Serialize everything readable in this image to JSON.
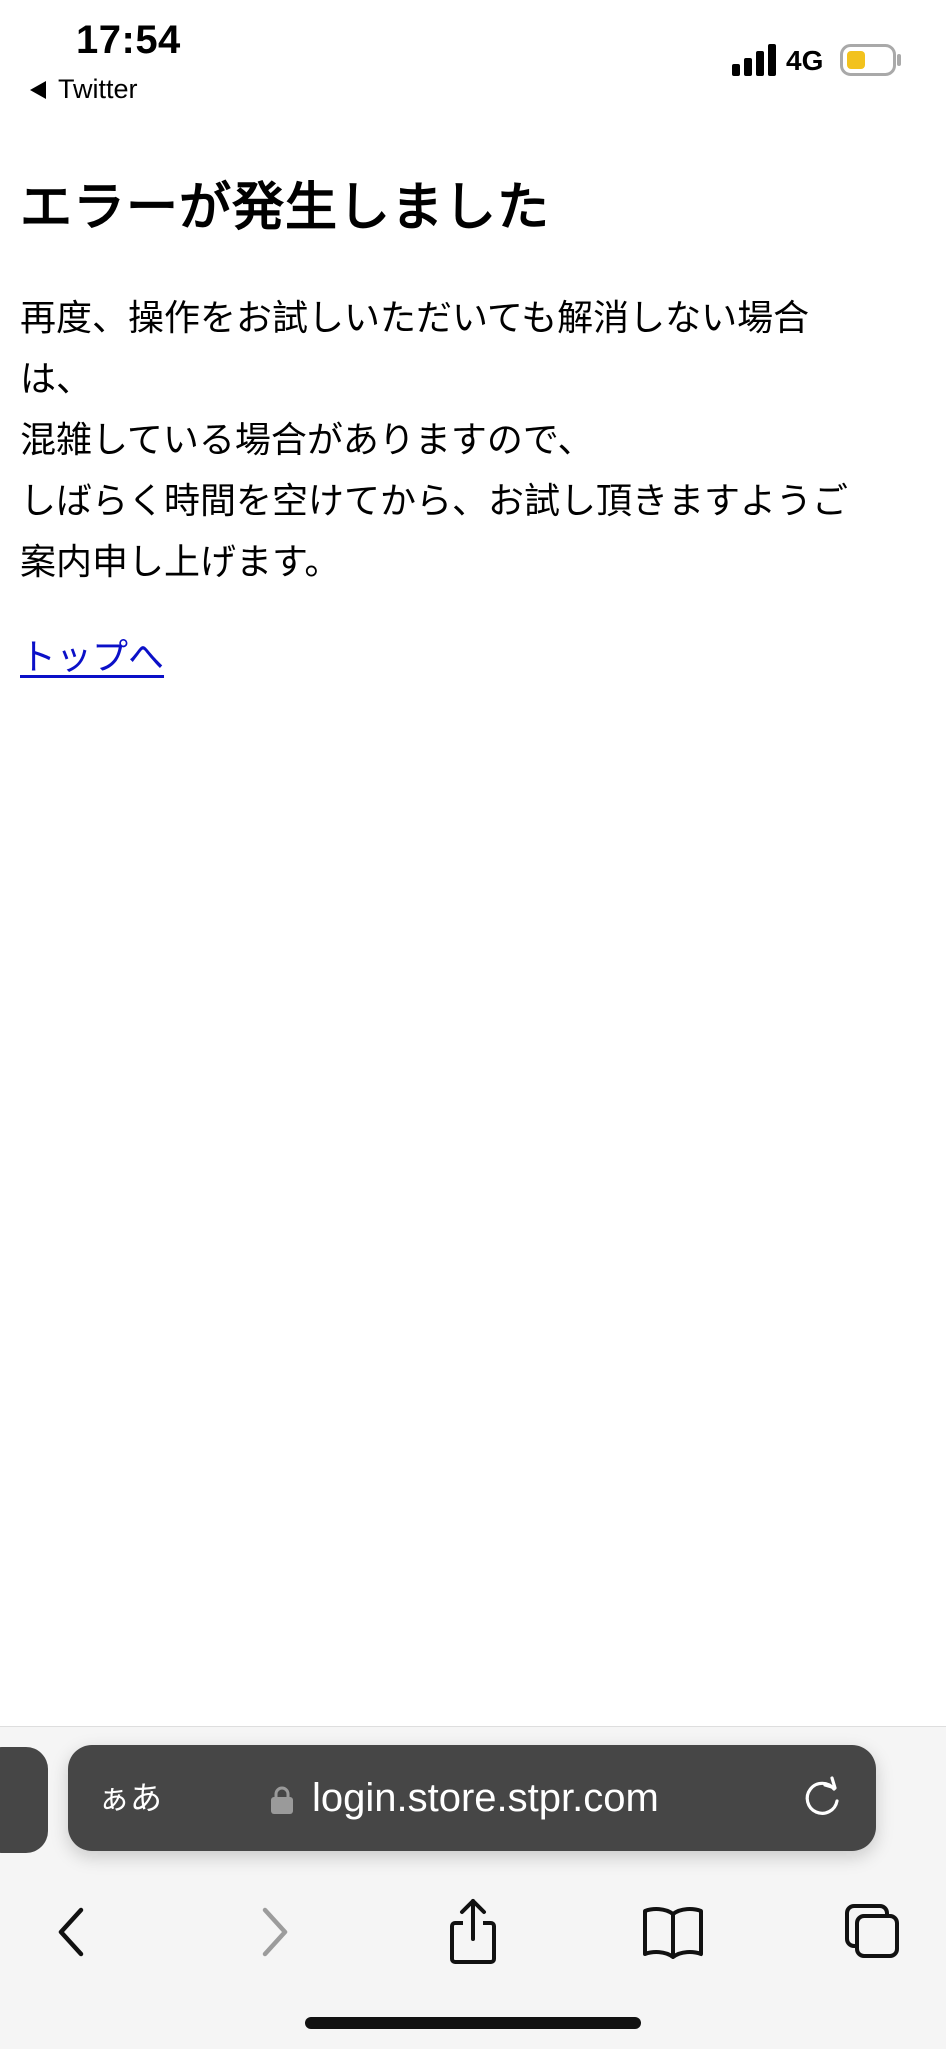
{
  "status_bar": {
    "time": "17:54",
    "back_app": "Twitter",
    "network": "4G",
    "battery_color": "#f2c21d"
  },
  "page": {
    "title": "エラーが発生しました",
    "message_lines": [
      "再度、操作をお試しいただいても解消しない場合",
      "は、",
      "混雑している場合がありますので、",
      "しばらく時間を空けてから、お試し頂きますようご",
      "案内申し上げます。"
    ],
    "top_link": "トップへ"
  },
  "browser": {
    "aa_label": "ぁあ",
    "url": "login.store.stpr.com",
    "icons": {
      "lock": "lock-icon",
      "reload": "reload-icon",
      "back": "back-arrow-icon",
      "forward": "forward-arrow-icon",
      "share": "share-icon",
      "bookmarks": "bookmarks-icon",
      "tabs": "tabs-icon"
    },
    "colors": {
      "url_bar": "#464646",
      "toolbar_bg": "#f5f5f5",
      "link": "#0b10c8"
    }
  }
}
